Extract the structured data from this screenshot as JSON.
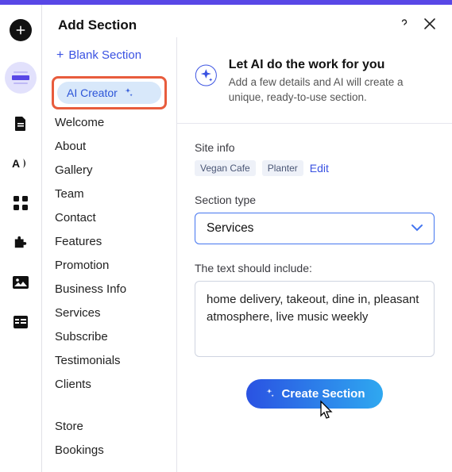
{
  "panel": {
    "title": "Add Section",
    "blank_label": "Blank Section",
    "ai_creator_label": "AI Creator"
  },
  "sidebar": {
    "items": [
      "Welcome",
      "About",
      "Gallery",
      "Team",
      "Contact",
      "Features",
      "Promotion",
      "Business Info",
      "Services",
      "Subscribe",
      "Testimonials",
      "Clients"
    ],
    "extras": [
      "Store",
      "Bookings"
    ]
  },
  "hero": {
    "title": "Let AI do the work for you",
    "subtitle": "Add a few details and AI will create a unique, ready-to-use section."
  },
  "site_info": {
    "label": "Site info",
    "tags": [
      "Vegan Cafe",
      "Planter"
    ],
    "edit": "Edit"
  },
  "section_type": {
    "label": "Section type",
    "value": "Services"
  },
  "text_include": {
    "label": "The text should include:",
    "value": "home delivery, takeout, dine in, pleasant atmosphere, live music weekly"
  },
  "cta": {
    "label": "Create Section"
  }
}
